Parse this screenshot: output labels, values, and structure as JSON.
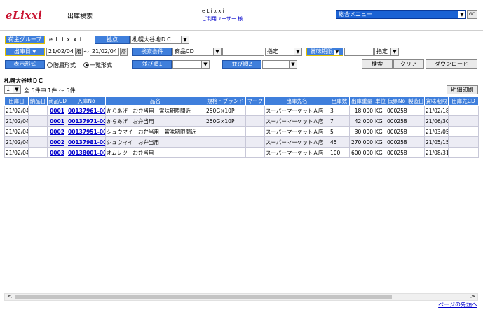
{
  "header": {
    "logo": "eLixxi",
    "page_title": "出庫検索",
    "company": "e L i x x i",
    "user_label": "ご利用ユーザー",
    "user_name": "様",
    "menu_select": "総合メニュー",
    "go_label": "GO"
  },
  "form": {
    "owner_group_label": "荷主グループ",
    "owner_group_value": "e L i x x i",
    "base_label": "拠点",
    "base_value": "札幌大谷地ＤＣ",
    "ship_date_label": "出庫日",
    "date_from": "21/02/04",
    "date_to": "21/02/04",
    "cal_icon": "暦",
    "date_sep": "～",
    "cond_label": "検索条件",
    "cond_value": "商品CD",
    "cond_match": "指定",
    "expiry_label": "賞味期限",
    "expiry_match": "指定",
    "display_label": "表示形式",
    "display_opt1": "階層形式",
    "display_opt2": "一覧形式",
    "sort1_label": "並び順1",
    "sort2_label": "並び順2",
    "search_btn": "検索",
    "clear_btn": "クリア",
    "download_btn": "ダウンロード"
  },
  "result": {
    "section_title": "札幌大谷地ＤＣ",
    "page_select": "1",
    "summary": "全 5件中 1件 ～ 5件",
    "print_btn": "明細印刷",
    "columns": [
      "出庫日",
      "納品日",
      "商品CD",
      "入庫No",
      "品名",
      "規格・ブランド",
      "マーク",
      "出庫先名",
      "出庫数",
      "出庫重量",
      "単位",
      "伝票No",
      "製造日",
      "賞味期限",
      "出庫先CD"
    ],
    "rows": [
      {
        "ship": "21/02/04",
        "deliv": "",
        "code": "0001",
        "in_no": "00137961-00",
        "name": "からあげ　お弁当用　賞味期限間近",
        "spec": "250G×10P",
        "mark": "",
        "dest": "スーパーマーケットＡ店",
        "qty": "3",
        "weight": "18.000",
        "unit": "KG",
        "slip": "0002583",
        "mfg": "",
        "expiry": "21/02/18",
        "dest_cd": ""
      },
      {
        "ship": "21/02/04",
        "deliv": "",
        "code": "0001",
        "in_no": "00137971-00",
        "name": "からあげ　お弁当用",
        "spec": "250G×10P",
        "mark": "",
        "dest": "スーパーマーケットＡ店",
        "qty": "7",
        "weight": "42.000",
        "unit": "KG",
        "slip": "0002584",
        "mfg": "",
        "expiry": "21/06/30",
        "dest_cd": ""
      },
      {
        "ship": "21/02/04",
        "deliv": "",
        "code": "0002",
        "in_no": "00137951-00",
        "name": "シュウマイ　お弁当用　賞味期限間近",
        "spec": "",
        "mark": "",
        "dest": "スーパーマーケットＡ店",
        "qty": "5",
        "weight": "30.000",
        "unit": "KG",
        "slip": "0002585",
        "mfg": "",
        "expiry": "21/03/05",
        "dest_cd": ""
      },
      {
        "ship": "21/02/04",
        "deliv": "",
        "code": "0002",
        "in_no": "00137981-00",
        "name": "シュウマイ　お弁当用",
        "spec": "",
        "mark": "",
        "dest": "スーパーマーケットＡ店",
        "qty": "45",
        "weight": "270.000",
        "unit": "KG",
        "slip": "0002586",
        "mfg": "",
        "expiry": "21/05/15",
        "dest_cd": ""
      },
      {
        "ship": "21/02/04",
        "deliv": "",
        "code": "0003",
        "in_no": "00138001-00",
        "name": "オムレツ　お弁当用",
        "spec": "",
        "mark": "",
        "dest": "スーパーマーケットＡ店",
        "qty": "100",
        "weight": "600.000",
        "unit": "KG",
        "slip": "0002587",
        "mfg": "",
        "expiry": "21/08/31",
        "dest_cd": ""
      }
    ]
  },
  "footer": {
    "scroll_left": "<",
    "scroll_right": ">",
    "next_page": "ページの先頭へ"
  },
  "colors": {
    "header_blue": "#3f7fdc",
    "menu_blue": "#1a62d4",
    "logo_red": "#c8102e",
    "link": "#0000cc"
  }
}
